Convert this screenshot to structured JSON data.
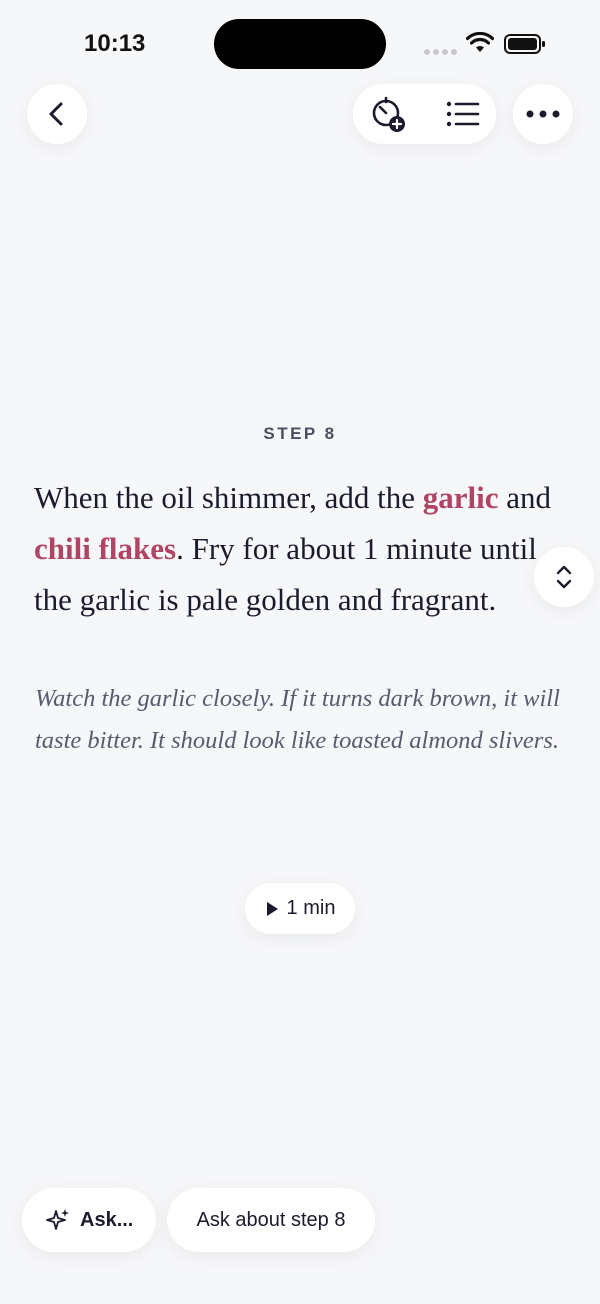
{
  "status": {
    "time": "10:13"
  },
  "toolbar": {
    "back_icon": "chevron-left-icon",
    "timer_icon": "timer-add-icon",
    "list_icon": "list-icon",
    "more_icon": "ellipsis-icon"
  },
  "step": {
    "label": "STEP 8",
    "text_parts": [
      {
        "text": "When the oil shimmer, add the ",
        "highlight": false
      },
      {
        "text": "garlic",
        "highlight": true
      },
      {
        "text": " and ",
        "highlight": false
      },
      {
        "text": "chili flakes",
        "highlight": true
      },
      {
        "text": ". Fry for about 1 minute until the garlic is pale golden and fragrant.",
        "highlight": false
      }
    ],
    "tip": "Watch the garlic closely. If it turns dark brown, it will taste bitter. It should look like toasted almond slivers.",
    "timer_label": "1 min"
  },
  "bottom": {
    "ask_label": "Ask...",
    "ask_step_label": "Ask about step 8"
  },
  "colors": {
    "background": "#f6f7f9",
    "highlight": "#b04462",
    "text": "#1c1b2e"
  }
}
